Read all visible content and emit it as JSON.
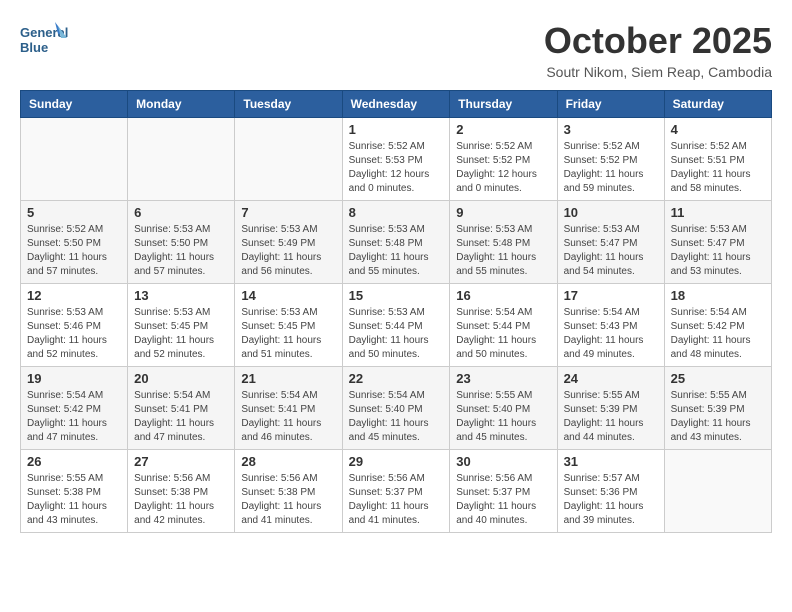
{
  "header": {
    "logo_line1": "General",
    "logo_line2": "Blue",
    "month_title": "October 2025",
    "location": "Soutr Nikom, Siem Reap, Cambodia"
  },
  "days_of_week": [
    "Sunday",
    "Monday",
    "Tuesday",
    "Wednesday",
    "Thursday",
    "Friday",
    "Saturday"
  ],
  "weeks": [
    [
      {
        "day": "",
        "sunrise": "",
        "sunset": "",
        "daylight": ""
      },
      {
        "day": "",
        "sunrise": "",
        "sunset": "",
        "daylight": ""
      },
      {
        "day": "",
        "sunrise": "",
        "sunset": "",
        "daylight": ""
      },
      {
        "day": "1",
        "sunrise": "Sunrise: 5:52 AM",
        "sunset": "Sunset: 5:53 PM",
        "daylight": "Daylight: 12 hours and 0 minutes."
      },
      {
        "day": "2",
        "sunrise": "Sunrise: 5:52 AM",
        "sunset": "Sunset: 5:52 PM",
        "daylight": "Daylight: 12 hours and 0 minutes."
      },
      {
        "day": "3",
        "sunrise": "Sunrise: 5:52 AM",
        "sunset": "Sunset: 5:52 PM",
        "daylight": "Daylight: 11 hours and 59 minutes."
      },
      {
        "day": "4",
        "sunrise": "Sunrise: 5:52 AM",
        "sunset": "Sunset: 5:51 PM",
        "daylight": "Daylight: 11 hours and 58 minutes."
      }
    ],
    [
      {
        "day": "5",
        "sunrise": "Sunrise: 5:52 AM",
        "sunset": "Sunset: 5:50 PM",
        "daylight": "Daylight: 11 hours and 57 minutes."
      },
      {
        "day": "6",
        "sunrise": "Sunrise: 5:53 AM",
        "sunset": "Sunset: 5:50 PM",
        "daylight": "Daylight: 11 hours and 57 minutes."
      },
      {
        "day": "7",
        "sunrise": "Sunrise: 5:53 AM",
        "sunset": "Sunset: 5:49 PM",
        "daylight": "Daylight: 11 hours and 56 minutes."
      },
      {
        "day": "8",
        "sunrise": "Sunrise: 5:53 AM",
        "sunset": "Sunset: 5:48 PM",
        "daylight": "Daylight: 11 hours and 55 minutes."
      },
      {
        "day": "9",
        "sunrise": "Sunrise: 5:53 AM",
        "sunset": "Sunset: 5:48 PM",
        "daylight": "Daylight: 11 hours and 55 minutes."
      },
      {
        "day": "10",
        "sunrise": "Sunrise: 5:53 AM",
        "sunset": "Sunset: 5:47 PM",
        "daylight": "Daylight: 11 hours and 54 minutes."
      },
      {
        "day": "11",
        "sunrise": "Sunrise: 5:53 AM",
        "sunset": "Sunset: 5:47 PM",
        "daylight": "Daylight: 11 hours and 53 minutes."
      }
    ],
    [
      {
        "day": "12",
        "sunrise": "Sunrise: 5:53 AM",
        "sunset": "Sunset: 5:46 PM",
        "daylight": "Daylight: 11 hours and 52 minutes."
      },
      {
        "day": "13",
        "sunrise": "Sunrise: 5:53 AM",
        "sunset": "Sunset: 5:45 PM",
        "daylight": "Daylight: 11 hours and 52 minutes."
      },
      {
        "day": "14",
        "sunrise": "Sunrise: 5:53 AM",
        "sunset": "Sunset: 5:45 PM",
        "daylight": "Daylight: 11 hours and 51 minutes."
      },
      {
        "day": "15",
        "sunrise": "Sunrise: 5:53 AM",
        "sunset": "Sunset: 5:44 PM",
        "daylight": "Daylight: 11 hours and 50 minutes."
      },
      {
        "day": "16",
        "sunrise": "Sunrise: 5:54 AM",
        "sunset": "Sunset: 5:44 PM",
        "daylight": "Daylight: 11 hours and 50 minutes."
      },
      {
        "day": "17",
        "sunrise": "Sunrise: 5:54 AM",
        "sunset": "Sunset: 5:43 PM",
        "daylight": "Daylight: 11 hours and 49 minutes."
      },
      {
        "day": "18",
        "sunrise": "Sunrise: 5:54 AM",
        "sunset": "Sunset: 5:42 PM",
        "daylight": "Daylight: 11 hours and 48 minutes."
      }
    ],
    [
      {
        "day": "19",
        "sunrise": "Sunrise: 5:54 AM",
        "sunset": "Sunset: 5:42 PM",
        "daylight": "Daylight: 11 hours and 47 minutes."
      },
      {
        "day": "20",
        "sunrise": "Sunrise: 5:54 AM",
        "sunset": "Sunset: 5:41 PM",
        "daylight": "Daylight: 11 hours and 47 minutes."
      },
      {
        "day": "21",
        "sunrise": "Sunrise: 5:54 AM",
        "sunset": "Sunset: 5:41 PM",
        "daylight": "Daylight: 11 hours and 46 minutes."
      },
      {
        "day": "22",
        "sunrise": "Sunrise: 5:54 AM",
        "sunset": "Sunset: 5:40 PM",
        "daylight": "Daylight: 11 hours and 45 minutes."
      },
      {
        "day": "23",
        "sunrise": "Sunrise: 5:55 AM",
        "sunset": "Sunset: 5:40 PM",
        "daylight": "Daylight: 11 hours and 45 minutes."
      },
      {
        "day": "24",
        "sunrise": "Sunrise: 5:55 AM",
        "sunset": "Sunset: 5:39 PM",
        "daylight": "Daylight: 11 hours and 44 minutes."
      },
      {
        "day": "25",
        "sunrise": "Sunrise: 5:55 AM",
        "sunset": "Sunset: 5:39 PM",
        "daylight": "Daylight: 11 hours and 43 minutes."
      }
    ],
    [
      {
        "day": "26",
        "sunrise": "Sunrise: 5:55 AM",
        "sunset": "Sunset: 5:38 PM",
        "daylight": "Daylight: 11 hours and 43 minutes."
      },
      {
        "day": "27",
        "sunrise": "Sunrise: 5:56 AM",
        "sunset": "Sunset: 5:38 PM",
        "daylight": "Daylight: 11 hours and 42 minutes."
      },
      {
        "day": "28",
        "sunrise": "Sunrise: 5:56 AM",
        "sunset": "Sunset: 5:38 PM",
        "daylight": "Daylight: 11 hours and 41 minutes."
      },
      {
        "day": "29",
        "sunrise": "Sunrise: 5:56 AM",
        "sunset": "Sunset: 5:37 PM",
        "daylight": "Daylight: 11 hours and 41 minutes."
      },
      {
        "day": "30",
        "sunrise": "Sunrise: 5:56 AM",
        "sunset": "Sunset: 5:37 PM",
        "daylight": "Daylight: 11 hours and 40 minutes."
      },
      {
        "day": "31",
        "sunrise": "Sunrise: 5:57 AM",
        "sunset": "Sunset: 5:36 PM",
        "daylight": "Daylight: 11 hours and 39 minutes."
      },
      {
        "day": "",
        "sunrise": "",
        "sunset": "",
        "daylight": ""
      }
    ]
  ]
}
